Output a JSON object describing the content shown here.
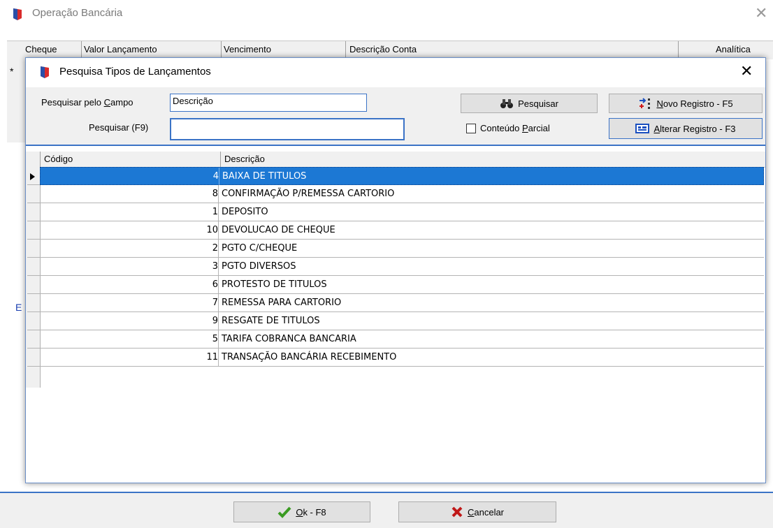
{
  "background_window": {
    "title": "Operação Bancária",
    "columns": [
      "Cheque",
      "Valor Lançamento",
      "Vencimento",
      "Descrição Conta",
      "Analítica"
    ],
    "row_marker": "*",
    "left_label": "E",
    "buttons": {
      "ok_label": "k - F8",
      "ok_mnemonic": "O",
      "cancel_label": "ancelar",
      "cancel_mnemonic": "C"
    }
  },
  "dialog": {
    "title": "Pesquisa Tipos de Lançamentos",
    "search_field_label_pre": "Pesquisar  pelo ",
    "search_field_label_mn": "C",
    "search_field_label_post": "ampo",
    "search_field_value": "Descrição",
    "search_label": "Pesquisar (F9)",
    "search_value": "",
    "search_button": "Pesquisar",
    "partial_label_pre": "Conteúdo ",
    "partial_label_mn": "P",
    "partial_label_post": "arcial",
    "partial_checked": false,
    "new_button_mn": "N",
    "new_button_rest": "ovo Registro - F5",
    "edit_button_mn": "A",
    "edit_button_rest": "lterar Registro - F3",
    "grid": {
      "headers": [
        "Código",
        "Descrição"
      ],
      "selected_index": 0,
      "rows": [
        {
          "code": "4",
          "desc": "BAIXA DE TITULOS"
        },
        {
          "code": "8",
          "desc": "CONFIRMAÇÃO P/REMESSA CARTORIO"
        },
        {
          "code": "1",
          "desc": "DEPOSITO"
        },
        {
          "code": "10",
          "desc": "DEVOLUCAO DE CHEQUE"
        },
        {
          "code": "2",
          "desc": "PGTO C/CHEQUE"
        },
        {
          "code": "3",
          "desc": "PGTO DIVERSOS"
        },
        {
          "code": "6",
          "desc": "PROTESTO DE TITULOS"
        },
        {
          "code": "7",
          "desc": "REMESSA PARA CARTORIO"
        },
        {
          "code": "9",
          "desc": "RESGATE DE TITULOS"
        },
        {
          "code": "5",
          "desc": "TARIFA COBRANCA BANCARIA"
        },
        {
          "code": "11",
          "desc": "TRANSAÇÃO BANCÁRIA RECEBIMENTO"
        }
      ]
    }
  },
  "colors": {
    "accent": "#3b73c6",
    "selection": "#1c78d4",
    "app_icon": "#d92b2b"
  }
}
